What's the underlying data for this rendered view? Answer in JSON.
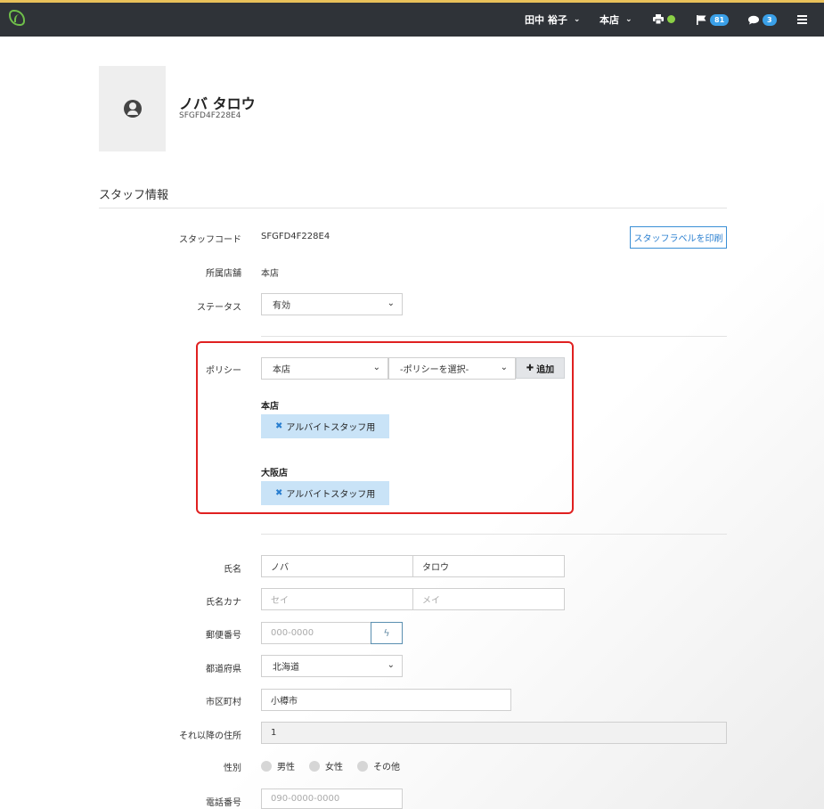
{
  "topbar": {
    "user_name": "田中 裕子",
    "store": "本店",
    "flag_count": "81",
    "chat_count": "3",
    "icons": [
      "logo-leaf-icon",
      "printer-icon",
      "flag-icon",
      "chat-icon",
      "menu-icon"
    ],
    "status_color": "#8bd046"
  },
  "profile": {
    "name": "ノバ タロウ",
    "code": "SFGFD4F228E4"
  },
  "section": {
    "title": "スタッフ情報"
  },
  "fields": {
    "staff_code_label": "スタッフコード",
    "staff_code_value": "SFGFD4F228E4",
    "print_label": "スタッフラベルを印刷",
    "store_label": "所属店舗",
    "store_value": "本店",
    "status_label": "ステータス",
    "status_value": "有効",
    "policy_label": "ポリシー",
    "policy_store_select": "本店",
    "policy_select_placeholder": "-ポリシーを選択-",
    "add_label": "追加",
    "name_label": "氏名",
    "last_name": "ノバ",
    "first_name": "タロウ",
    "kana_label": "氏名カナ",
    "kana_last_placeholder": "セイ",
    "kana_first_placeholder": "メイ",
    "zip_label": "郵便番号",
    "zip_placeholder": "000-0000",
    "pref_label": "都道府県",
    "pref_value": "北海道",
    "city_label": "市区町村",
    "city_value": "小樽市",
    "address_label": "それ以降の住所",
    "address_value": "1",
    "gender_label": "性別",
    "gender_options": [
      "男性",
      "女性",
      "その他"
    ],
    "phone_label": "電話番号",
    "phone_placeholder": "090-0000-0000"
  },
  "policies": [
    {
      "store": "本店",
      "tag": "アルバイトスタッフ用"
    },
    {
      "store": "大阪店",
      "tag": "アルバイトスタッフ用"
    }
  ],
  "colors": {
    "accent": "#2a7fd0",
    "highlight": "#e02020",
    "tag_bg": "#c9e3f7",
    "topbar_bg": "#2f3338"
  }
}
